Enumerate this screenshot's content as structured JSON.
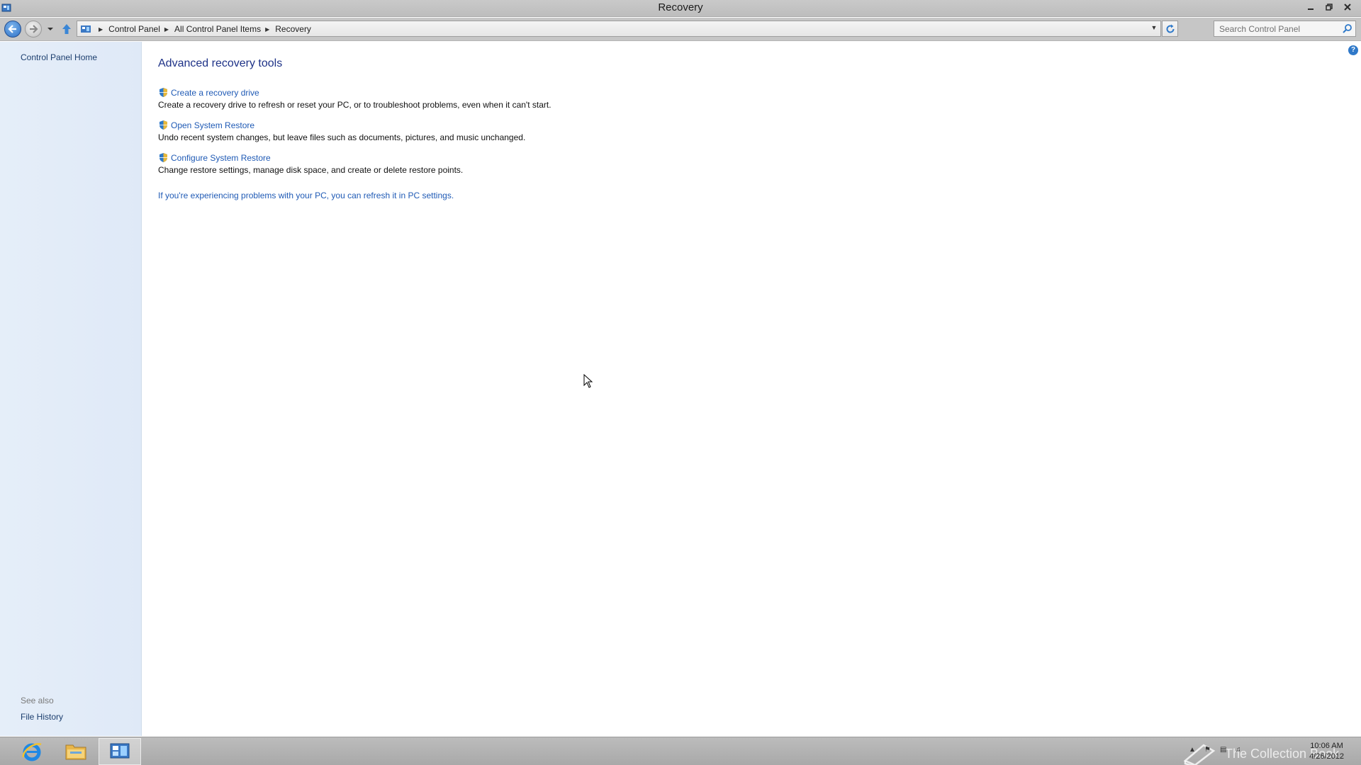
{
  "window": {
    "title": "Recovery",
    "caption_buttons": [
      "minimize",
      "restore",
      "close"
    ]
  },
  "navbar": {
    "breadcrumbs": [
      "Control Panel",
      "All Control Panel Items",
      "Recovery"
    ],
    "search_placeholder": "Search Control Panel"
  },
  "left_pane": {
    "home_link": "Control Panel Home",
    "see_also_label": "See also",
    "see_also_items": [
      "File History"
    ]
  },
  "main": {
    "heading": "Advanced recovery tools",
    "tasks": [
      {
        "label": "Create a recovery drive",
        "description": "Create a recovery drive to refresh or reset your PC, or to troubleshoot problems, even when it can't start."
      },
      {
        "label": "Open System Restore",
        "description": "Undo recent system changes, but leave files such as documents, pictures, and music unchanged."
      },
      {
        "label": "Configure System Restore",
        "description": "Change restore settings, manage disk space, and create or delete restore points."
      }
    ],
    "pc_settings_link": "If you're experiencing problems with your PC, you can refresh it in PC settings."
  },
  "taskbar": {
    "pinned": [
      "internet-explorer",
      "file-explorer",
      "control-panel"
    ],
    "watermark": "The Collection Book",
    "clock_time": "10:06 AM",
    "clock_date": "4/26/2012"
  },
  "colors": {
    "link": "#1f5ab5",
    "heading": "#1e3287",
    "left_pane_bg": "#e5eef9"
  }
}
